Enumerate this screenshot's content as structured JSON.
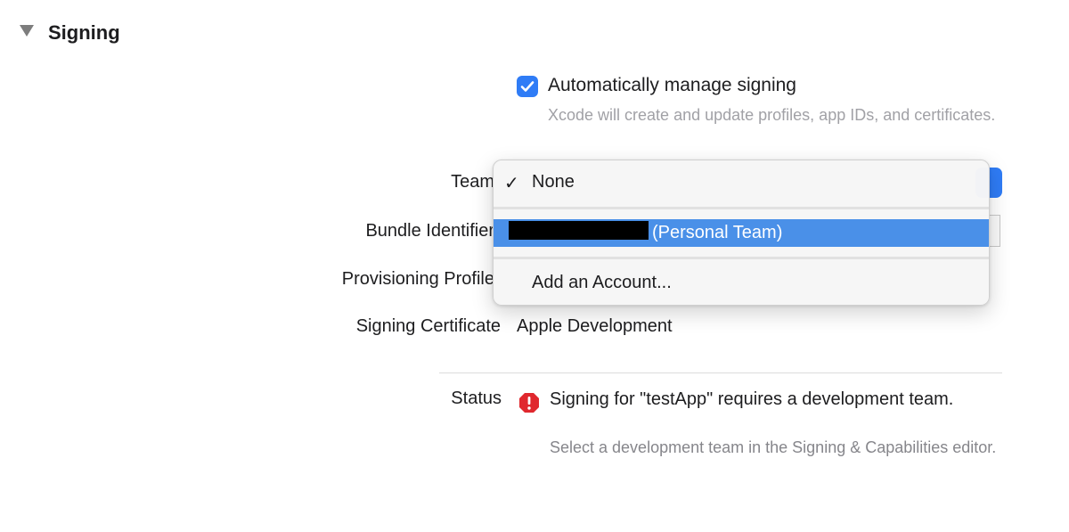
{
  "section": {
    "title": "Signing",
    "icon": "disclosure-triangle-icon"
  },
  "auto_manage": {
    "checked": true,
    "label": "Automatically manage signing",
    "description": "Xcode will create and update profiles, app IDs, and certificates."
  },
  "fields": {
    "team_label": "Team",
    "bundle_label": "Bundle Identifier",
    "provisioning_label": "Provisioning Profile",
    "certificate_label": "Signing Certificate",
    "certificate_value": "Apple Development",
    "status_label": "Status"
  },
  "team_menu": {
    "items": [
      {
        "label": "None",
        "checked": true
      },
      {
        "label": "(Personal Team)",
        "highlighted": true,
        "redacted_prefix": true
      },
      {
        "label": "Add an Account..."
      }
    ],
    "accent_color": "#4a90e8"
  },
  "status": {
    "icon": "error-icon",
    "message": "Signing for \"testApp\" requires a development team.",
    "hint": "Select a development team in the Signing & Capabilities editor."
  },
  "colors": {
    "accent": "#2f7cf6",
    "error": "#e0282e"
  }
}
